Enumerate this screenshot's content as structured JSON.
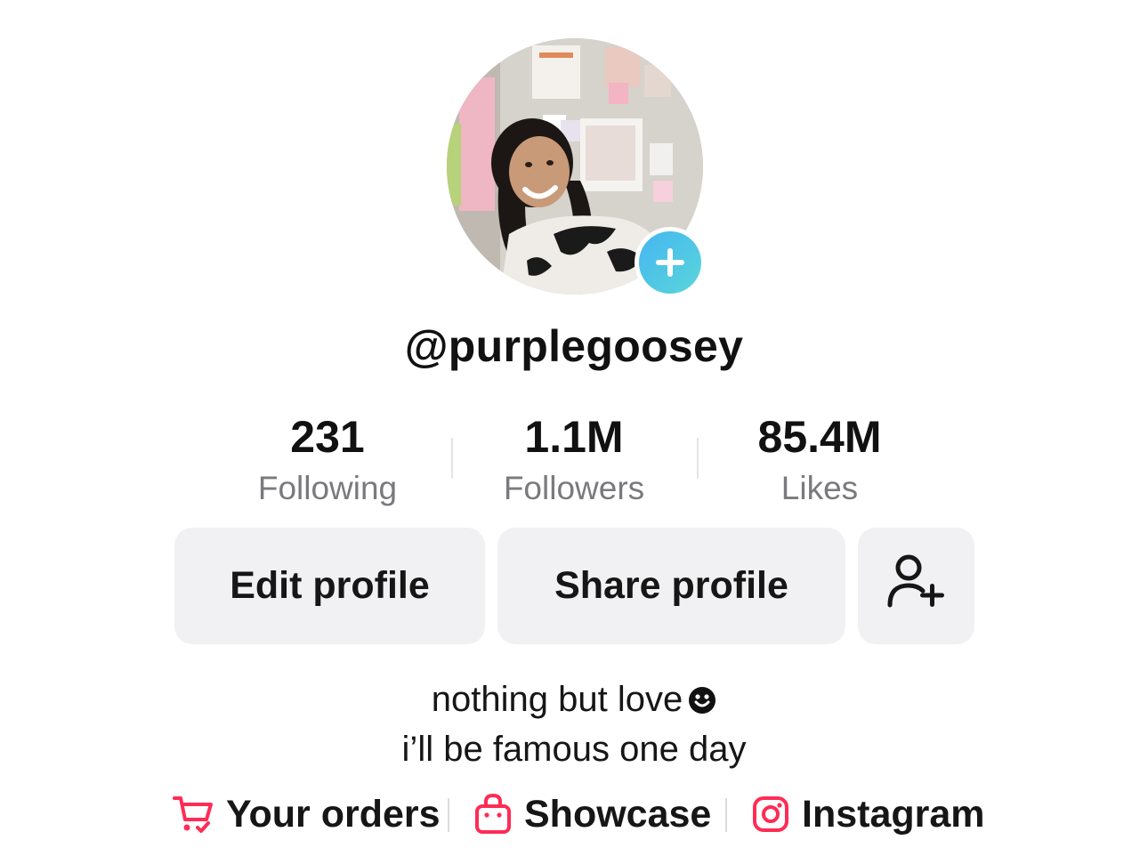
{
  "profile": {
    "username": "@purplegoosey",
    "avatar_alt": "profile photo",
    "add_icon": "plus-icon"
  },
  "stats": [
    {
      "value": "231",
      "label": "Following"
    },
    {
      "value": "1.1M",
      "label": "Followers"
    },
    {
      "value": "85.4M",
      "label": "Likes"
    }
  ],
  "actions": {
    "edit_label": "Edit profile",
    "share_label": "Share profile",
    "add_friend_icon": "add-user-icon"
  },
  "bio": {
    "line1": "nothing but love",
    "line2": "i’ll be famous one day",
    "emoji_icon": "smiley-icon"
  },
  "links": [
    {
      "label": "Your orders",
      "icon": "cart-icon"
    },
    {
      "label": "Showcase",
      "icon": "shopping-bag-icon"
    },
    {
      "label": "Instagram",
      "icon": "instagram-icon"
    }
  ],
  "colors": {
    "accent_pink": "#fe2c55",
    "badge_gradient_start": "#45b6f2",
    "badge_gradient_end": "#5ad6d9",
    "button_bg": "#f1f1f3",
    "muted_text": "#7a7a7e"
  }
}
